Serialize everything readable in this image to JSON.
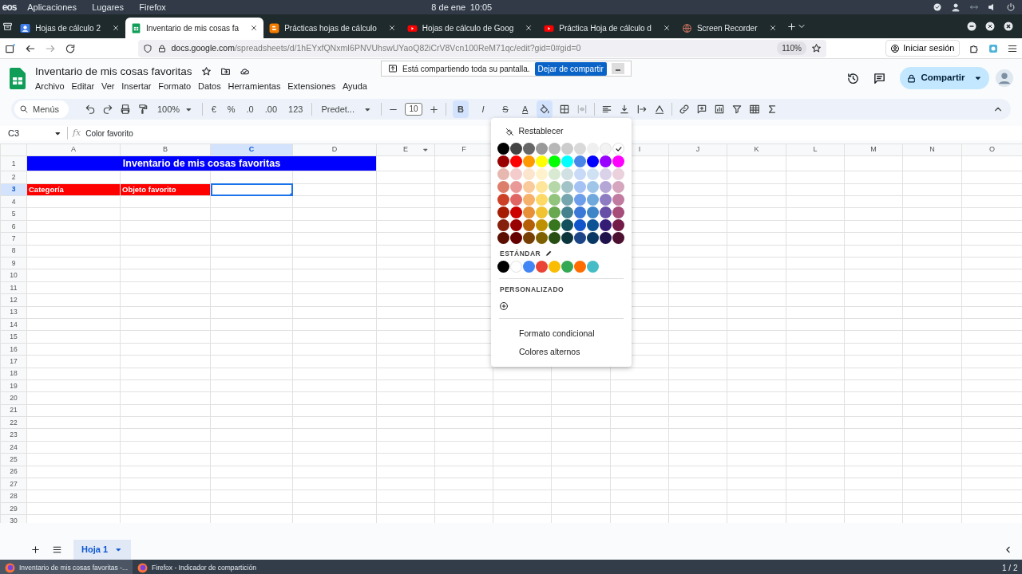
{
  "system_bar": {
    "logo": "eos",
    "menus": [
      "Aplicaciones",
      "Lugares",
      "Firefox"
    ],
    "date": "8 de ene",
    "time": "10:05"
  },
  "browser_tabs": [
    {
      "title": "Hojas de cálculo 2",
      "kind": "account",
      "selected": false
    },
    {
      "title": "Inventario de mis cosas fa",
      "kind": "sheets",
      "selected": true
    },
    {
      "title": "Prácticas hojas de cálculo",
      "kind": "blogger",
      "selected": false
    },
    {
      "title": "Hojas de cálculo de Goog",
      "kind": "youtube",
      "selected": false
    },
    {
      "title": "Práctica Hoja de cálculo d",
      "kind": "youtube",
      "selected": false
    },
    {
      "title": "Screen Recorder",
      "kind": "globe",
      "selected": false
    }
  ],
  "address_bar": {
    "host": "docs.google.com",
    "path": "/spreadsheets/d/1hEYxfQNxmI6PNVUhswUYaoQ82iCrV8Vcn100ReM71qc/edit?gid=0#gid=0",
    "zoom": "110%",
    "sign_in": "Iniciar sesión"
  },
  "sharing_notice": {
    "text": "Está compartiendo toda su pantalla.",
    "stop_button": "Dejar de compartir"
  },
  "document": {
    "title": "Inventario de mis cosas favoritas",
    "menus": [
      "Archivo",
      "Editar",
      "Ver",
      "Insertar",
      "Formato",
      "Datos",
      "Herramientas",
      "Extensiones",
      "Ayuda"
    ],
    "share_button": "Compartir"
  },
  "toolbar": {
    "search": "Menús",
    "zoom": "100%",
    "currency": "€",
    "percent": "%",
    "fewer_decimals": ".0",
    "more_decimals": ".00",
    "number_format": "123",
    "font": "Predet...",
    "font_size": "10",
    "bold": {
      "label": "B",
      "selected": true
    },
    "italic": {
      "label": "I",
      "selected": false
    },
    "strikethrough": {
      "label": "S",
      "selected": false
    },
    "text_color": "A",
    "fill_color": {
      "selected": true
    },
    "merge": {
      "disabled": true
    }
  },
  "formula_bar": {
    "name_box": "C3",
    "fx": "fx",
    "value": "Color favorito"
  },
  "grid": {
    "columns": [
      {
        "label": "A",
        "selected": false
      },
      {
        "label": "B",
        "selected": false
      },
      {
        "label": "C",
        "selected": true
      },
      {
        "label": "D",
        "selected": false
      },
      {
        "label": "E",
        "selected": false,
        "dropdown": true
      },
      {
        "label": "F",
        "selected": false
      },
      {
        "label": "I",
        "selected": false
      },
      {
        "label": "J",
        "selected": false
      },
      {
        "label": "K",
        "selected": false
      },
      {
        "label": "L",
        "selected": false
      },
      {
        "label": "M",
        "selected": false
      },
      {
        "label": "N",
        "selected": false
      },
      {
        "label": "O",
        "selected": false
      }
    ],
    "rows": [
      {
        "label": "1",
        "selected": false,
        "cells": [
          {
            "kind": "title",
            "text": "Inventario de mis cosas favoritas",
            "color": "#0000ff"
          }
        ]
      },
      {
        "label": "2",
        "selected": false
      },
      {
        "label": "3",
        "selected": true,
        "cells": [
          {
            "kind": "label",
            "text": "Categoría",
            "color": "#ff0000"
          },
          {
            "kind": "label",
            "text": "Objeto favorito",
            "color": "#ff0000"
          }
        ]
      },
      {
        "label": "4",
        "selected": false
      },
      {
        "label": "5",
        "selected": false
      },
      {
        "label": "6",
        "selected": false
      },
      {
        "label": "7",
        "selected": false
      },
      {
        "label": "8",
        "selected": false
      },
      {
        "label": "9",
        "selected": false
      },
      {
        "label": "10",
        "selected": false
      },
      {
        "label": "11",
        "selected": false
      },
      {
        "label": "12",
        "selected": false
      },
      {
        "label": "13",
        "selected": false
      },
      {
        "label": "14",
        "selected": false
      },
      {
        "label": "15",
        "selected": false
      },
      {
        "label": "16",
        "selected": false
      },
      {
        "label": "17",
        "selected": false
      },
      {
        "label": "18",
        "selected": false
      },
      {
        "label": "19",
        "selected": false
      },
      {
        "label": "20",
        "selected": false
      },
      {
        "label": "21",
        "selected": false
      },
      {
        "label": "22",
        "selected": false
      },
      {
        "label": "23",
        "selected": false
      },
      {
        "label": "24",
        "selected": false
      },
      {
        "label": "25",
        "selected": false
      },
      {
        "label": "26",
        "selected": false
      },
      {
        "label": "27",
        "selected": false
      },
      {
        "label": "28",
        "selected": false
      },
      {
        "label": "29",
        "selected": false
      },
      {
        "label": "30",
        "selected": false
      }
    ]
  },
  "fill_color_menu": {
    "reset": "Restablecer",
    "palette": [
      {
        "swatches": [
          {
            "color": "#000000",
            "selected": false
          },
          {
            "color": "#434343",
            "selected": false
          },
          {
            "color": "#666666",
            "selected": false
          },
          {
            "color": "#999999",
            "selected": false
          },
          {
            "color": "#b7b7b7",
            "selected": false
          },
          {
            "color": "#cccccc",
            "selected": false
          },
          {
            "color": "#d9d9d9",
            "selected": false
          },
          {
            "color": "#efefef",
            "selected": false
          },
          {
            "color": "#f3f3f3",
            "selected": false
          },
          {
            "color": "#ffffff",
            "selected": true
          }
        ]
      },
      {
        "swatches": [
          {
            "color": "#980000",
            "selected": false
          },
          {
            "color": "#ff0000",
            "selected": false
          },
          {
            "color": "#ff9900",
            "selected": false
          },
          {
            "color": "#ffff00",
            "selected": false
          },
          {
            "color": "#00ff00",
            "selected": false
          },
          {
            "color": "#00ffff",
            "selected": false
          },
          {
            "color": "#4a86e8",
            "selected": false
          },
          {
            "color": "#0000ff",
            "selected": false
          },
          {
            "color": "#9900ff",
            "selected": false
          },
          {
            "color": "#ff00ff",
            "selected": false
          }
        ]
      },
      {
        "swatches": [
          {
            "color": "#e6b8af",
            "selected": false
          },
          {
            "color": "#f4cccc",
            "selected": false
          },
          {
            "color": "#fce5cd",
            "selected": false
          },
          {
            "color": "#fff2cc",
            "selected": false
          },
          {
            "color": "#d9ead3",
            "selected": false
          },
          {
            "color": "#d0e0e3",
            "selected": false
          },
          {
            "color": "#c9daf8",
            "selected": false
          },
          {
            "color": "#cfe2f3",
            "selected": false
          },
          {
            "color": "#d9d2e9",
            "selected": false
          },
          {
            "color": "#ead1dc",
            "selected": false
          }
        ]
      },
      {
        "swatches": [
          {
            "color": "#dd7e6b",
            "selected": false
          },
          {
            "color": "#ea9999",
            "selected": false
          },
          {
            "color": "#f9cb9c",
            "selected": false
          },
          {
            "color": "#ffe599",
            "selected": false
          },
          {
            "color": "#b6d7a8",
            "selected": false
          },
          {
            "color": "#a2c4c9",
            "selected": false
          },
          {
            "color": "#a4c2f4",
            "selected": false
          },
          {
            "color": "#9fc5e8",
            "selected": false
          },
          {
            "color": "#b4a7d6",
            "selected": false
          },
          {
            "color": "#d5a6bd",
            "selected": false
          }
        ]
      },
      {
        "swatches": [
          {
            "color": "#cc4125",
            "selected": false
          },
          {
            "color": "#e06666",
            "selected": false
          },
          {
            "color": "#f6b26b",
            "selected": false
          },
          {
            "color": "#ffd966",
            "selected": false
          },
          {
            "color": "#93c47d",
            "selected": false
          },
          {
            "color": "#76a5af",
            "selected": false
          },
          {
            "color": "#6d9eeb",
            "selected": false
          },
          {
            "color": "#6fa8dc",
            "selected": false
          },
          {
            "color": "#8e7cc3",
            "selected": false
          },
          {
            "color": "#c27ba0",
            "selected": false
          }
        ]
      },
      {
        "swatches": [
          {
            "color": "#a61c00",
            "selected": false
          },
          {
            "color": "#cc0000",
            "selected": false
          },
          {
            "color": "#e69138",
            "selected": false
          },
          {
            "color": "#f1c232",
            "selected": false
          },
          {
            "color": "#6aa84f",
            "selected": false
          },
          {
            "color": "#45818e",
            "selected": false
          },
          {
            "color": "#3c78d8",
            "selected": false
          },
          {
            "color": "#3d85c6",
            "selected": false
          },
          {
            "color": "#674ea7",
            "selected": false
          },
          {
            "color": "#a64d79",
            "selected": false
          }
        ]
      },
      {
        "swatches": [
          {
            "color": "#85200c",
            "selected": false
          },
          {
            "color": "#990000",
            "selected": false
          },
          {
            "color": "#b45f06",
            "selected": false
          },
          {
            "color": "#bf9000",
            "selected": false
          },
          {
            "color": "#38761d",
            "selected": false
          },
          {
            "color": "#134f5c",
            "selected": false
          },
          {
            "color": "#1155cc",
            "selected": false
          },
          {
            "color": "#0b5394",
            "selected": false
          },
          {
            "color": "#351c75",
            "selected": false
          },
          {
            "color": "#741b47",
            "selected": false
          }
        ]
      },
      {
        "swatches": [
          {
            "color": "#5b0f00",
            "selected": false
          },
          {
            "color": "#660000",
            "selected": false
          },
          {
            "color": "#783f04",
            "selected": false
          },
          {
            "color": "#7f6000",
            "selected": false
          },
          {
            "color": "#274e13",
            "selected": false
          },
          {
            "color": "#0c343d",
            "selected": false
          },
          {
            "color": "#1c4587",
            "selected": false
          },
          {
            "color": "#073763",
            "selected": false
          },
          {
            "color": "#20124d",
            "selected": false
          },
          {
            "color": "#4c1130",
            "selected": false
          }
        ]
      }
    ],
    "standard_label": "ESTÁNDAR",
    "standard": [
      {
        "color": "#000000",
        "selected": false
      },
      {
        "color": "#ffffff",
        "selected": false
      },
      {
        "color": "#4285f4",
        "selected": false
      },
      {
        "color": "#ea4335",
        "selected": false
      },
      {
        "color": "#fbbc04",
        "selected": false
      },
      {
        "color": "#34a853",
        "selected": false
      },
      {
        "color": "#ff6d01",
        "selected": false
      },
      {
        "color": "#46bdc6",
        "selected": false
      }
    ],
    "custom_label": "PERSONALIZADO",
    "options": [
      "Formato condicional",
      "Colores alternos"
    ]
  },
  "sheet_tabs": [
    {
      "label": "Hoja 1",
      "selected": true
    }
  ],
  "taskbar": {
    "windows": [
      {
        "title": "Inventario de mis cosas favoritas -...",
        "selected": true
      },
      {
        "title": "Firefox - Indicador de compartición",
        "selected": false
      }
    ],
    "pager": "1 / 2"
  }
}
